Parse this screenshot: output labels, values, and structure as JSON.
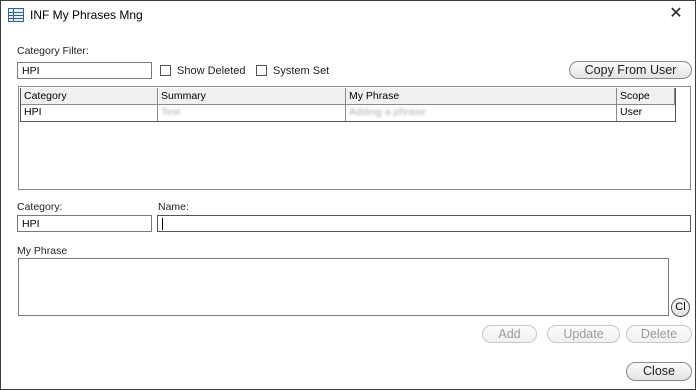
{
  "window": {
    "title": "INF My Phrases Mng",
    "close_glyph": "✕"
  },
  "filter": {
    "label": "Category Filter:",
    "value": "HPI",
    "show_deleted_label": "Show Deleted",
    "system_set_label": "System Set",
    "show_deleted_checked": false,
    "system_set_checked": false
  },
  "copy_button": "Copy From User",
  "grid": {
    "columns": [
      "Category",
      "Summary",
      "My Phrase",
      "Scope"
    ],
    "rows": [
      {
        "category": "HPI",
        "summary": "Test",
        "phrase": "Adding a phrase",
        "scope": "User"
      }
    ]
  },
  "form": {
    "category_label": "Category:",
    "category_value": "HPI",
    "name_label": "Name:",
    "name_value": "",
    "phrase_label": "My Phrase",
    "phrase_value": "",
    "clear_label": "Cl"
  },
  "actions": {
    "add": "Add",
    "update": "Update",
    "delete": "Delete",
    "close": "Close"
  }
}
